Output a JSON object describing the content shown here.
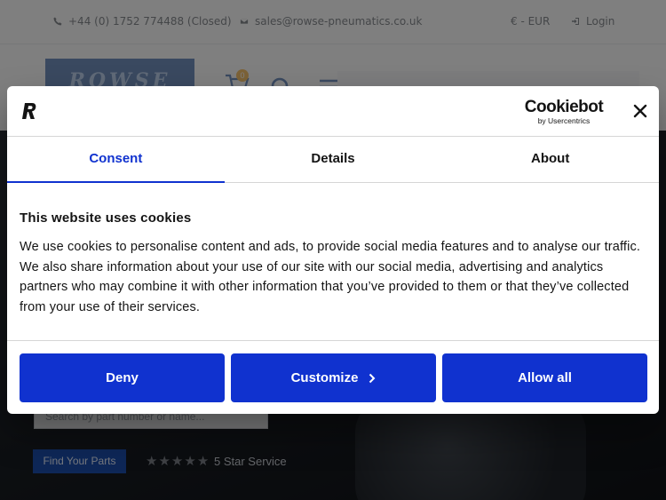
{
  "topbar": {
    "phone": "+44 (0) 1752 774488 (Closed)",
    "email": "sales@rowse-pneumatics.co.uk",
    "currency": "€ - EUR",
    "login": "Login"
  },
  "header": {
    "logo_text": "ROWSE",
    "cart_count": "0"
  },
  "hero": {
    "search_placeholder": "Search by part number or name...",
    "find_button": "Find Your Parts",
    "rating_text": "5 Star Service",
    "stars": 5
  },
  "cookie_dialog": {
    "brand_mark": "R",
    "provider_name": "Cookiebot",
    "provider_sub": "by Usercentrics",
    "tabs": [
      {
        "label": "Consent",
        "active": true
      },
      {
        "label": "Details",
        "active": false
      },
      {
        "label": "About",
        "active": false
      }
    ],
    "heading": "This website uses cookies",
    "text": "We use cookies to personalise content and ads, to provide social media features and to analyse our traffic. We also share information about your use of our site with our social media, advertising and analytics partners who may combine it with other information that you’ve provided to them or that they’ve collected from your use of their services.",
    "buttons": {
      "deny": "Deny",
      "customize": "Customize",
      "allow_all": "Allow all"
    }
  },
  "colors": {
    "primary": "#1032cf",
    "text": "#141414",
    "divider": "#d6d6d6"
  }
}
